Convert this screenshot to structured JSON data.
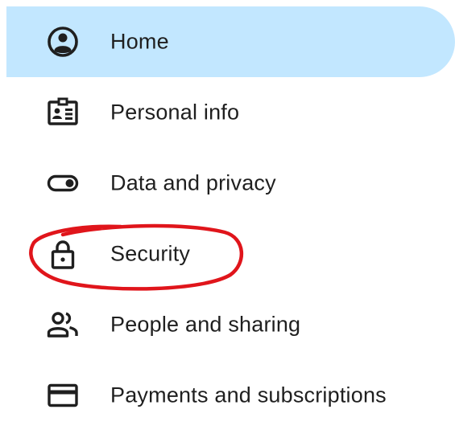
{
  "colors": {
    "active_background": "#c2e7ff",
    "text": "#1f1f1f",
    "icon": "#1f1f1f",
    "annotation_circle": "#e0151b"
  },
  "nav": {
    "items": [
      {
        "label": "Home",
        "icon": "account-circle-icon",
        "active": true
      },
      {
        "label": "Personal info",
        "icon": "badge-icon",
        "active": false
      },
      {
        "label": "Data and privacy",
        "icon": "toggle-icon",
        "active": false
      },
      {
        "label": "Security",
        "icon": "lock-icon",
        "active": false
      },
      {
        "label": "People and sharing",
        "icon": "people-icon",
        "active": false
      },
      {
        "label": "Payments and subscriptions",
        "icon": "credit-card-icon",
        "active": false
      }
    ]
  }
}
